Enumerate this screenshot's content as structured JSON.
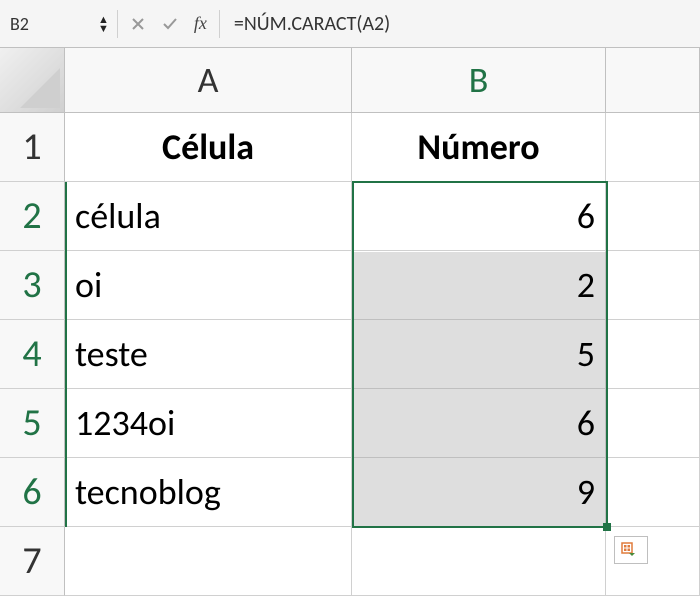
{
  "formula_bar": {
    "name_box": "B2",
    "formula": "=NÚM.CARACT(A2)"
  },
  "columns": [
    "A",
    "B"
  ],
  "rows": [
    "1",
    "2",
    "3",
    "4",
    "5",
    "6",
    "7"
  ],
  "table": {
    "headers": {
      "A": "Célula",
      "B": "Número"
    },
    "data": [
      {
        "A": "célula",
        "B": "6"
      },
      {
        "A": "oi",
        "B": "2"
      },
      {
        "A": "teste",
        "B": "5"
      },
      {
        "A": "1234oi",
        "B": "6"
      },
      {
        "A": "tecnoblog",
        "B": "9"
      }
    ]
  },
  "chart_data": {
    "type": "table",
    "title": "",
    "columns": [
      "Célula",
      "Número"
    ],
    "rows": [
      [
        "célula",
        6
      ],
      [
        "oi",
        2
      ],
      [
        "teste",
        5
      ],
      [
        "1234oi",
        6
      ],
      [
        "tecnoblog",
        9
      ]
    ]
  }
}
